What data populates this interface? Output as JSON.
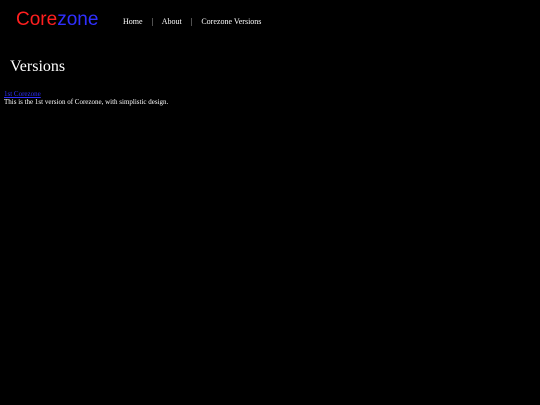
{
  "brand": {
    "part1": "Core",
    "part2": "zone",
    "part1_color": "#ff1f1f",
    "part2_color": "#2f2fff"
  },
  "nav": {
    "items": [
      {
        "label": "Home"
      },
      {
        "label": "About"
      },
      {
        "label": "Corezone Versions"
      }
    ],
    "separator": "|"
  },
  "main": {
    "title": "Versions",
    "entries": [
      {
        "link_text": "1st Corezone",
        "description": "This is the 1st version of Corezone, with simplistic design."
      }
    ]
  },
  "colors": {
    "background": "#000000",
    "text": "#ffffff",
    "link": "#2f2fff"
  }
}
